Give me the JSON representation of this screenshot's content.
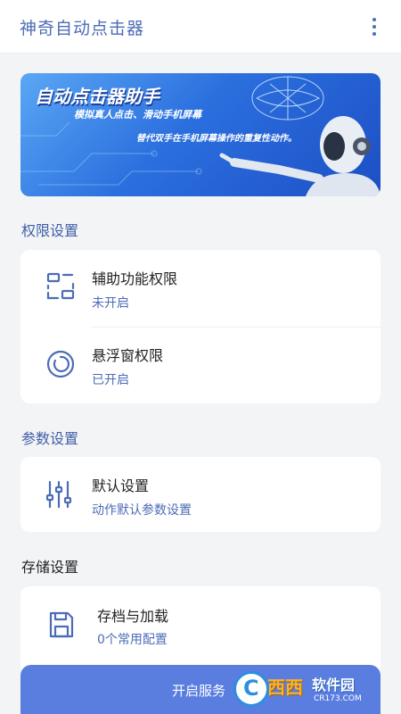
{
  "appbar": {
    "title": "神奇自动点击器"
  },
  "banner": {
    "title": "自动点击器助手",
    "subtitle1": "模拟真人点击、滑动手机屏幕",
    "subtitle2": "替代双手在手机屏幕操作的重复性动作。"
  },
  "sections": {
    "permissions": {
      "label": "权限设置",
      "items": [
        {
          "title": "辅助功能权限",
          "status": "未开启",
          "icon": "accessibility-icon"
        },
        {
          "title": "悬浮窗权限",
          "status": "已开启",
          "icon": "floating-window-icon"
        }
      ]
    },
    "parameters": {
      "label": "参数设置",
      "items": [
        {
          "title": "默认设置",
          "status": "动作默认参数设置",
          "icon": "sliders-icon"
        }
      ]
    },
    "storage": {
      "label": "存储设置",
      "items": [
        {
          "title": "存档与加载",
          "status": "0个常用配置",
          "icon": "save-icon"
        }
      ]
    }
  },
  "start_button": {
    "label": "开启服务"
  },
  "watermark": {
    "brand": "西西",
    "tagline": "软件园",
    "domain": "CR173.COM"
  },
  "colors": {
    "accent": "#4d6cb6",
    "button": "#5a7ee0",
    "background": "#f3f4f6"
  }
}
